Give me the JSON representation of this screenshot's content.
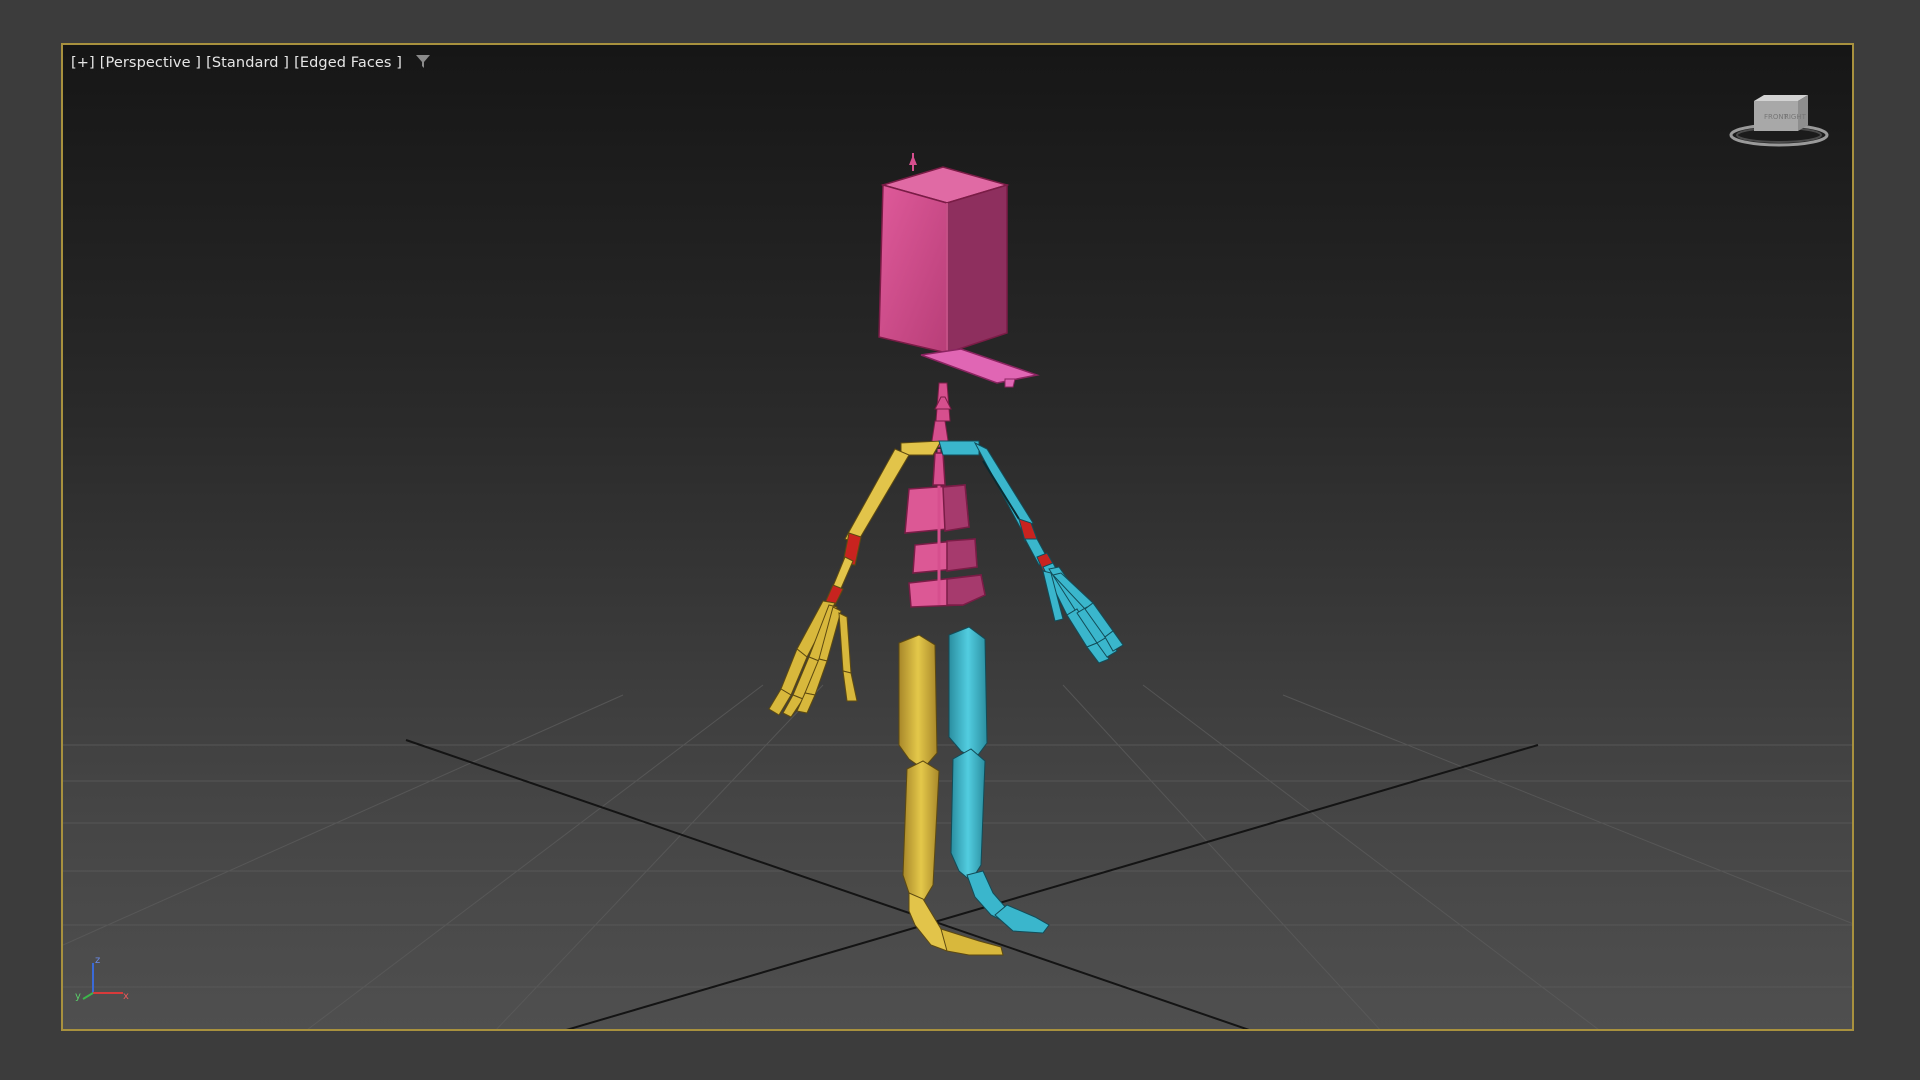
{
  "viewport": {
    "menu_label": "[+]",
    "view_label": "[Perspective ]",
    "shading_label": "[Standard ]",
    "edged_label": "[Edged Faces ]",
    "filter_icon": "funnel-icon",
    "border_color": "#a8913e"
  },
  "viewcube": {
    "icon": "viewcube-icon",
    "front_label": "FRONT",
    "right_label": "RIGHT"
  },
  "axis_tripod": {
    "x_label": "x",
    "y_label": "y",
    "z_label": "z",
    "x_color": "#d83a3a",
    "y_color": "#3cb64a",
    "z_color": "#3a6ad8"
  },
  "rig": {
    "spine_color": "#d64f8e",
    "left_side_color": "#d8b83c",
    "right_side_color": "#3ab6cc",
    "joint_color": "#c8231f"
  }
}
